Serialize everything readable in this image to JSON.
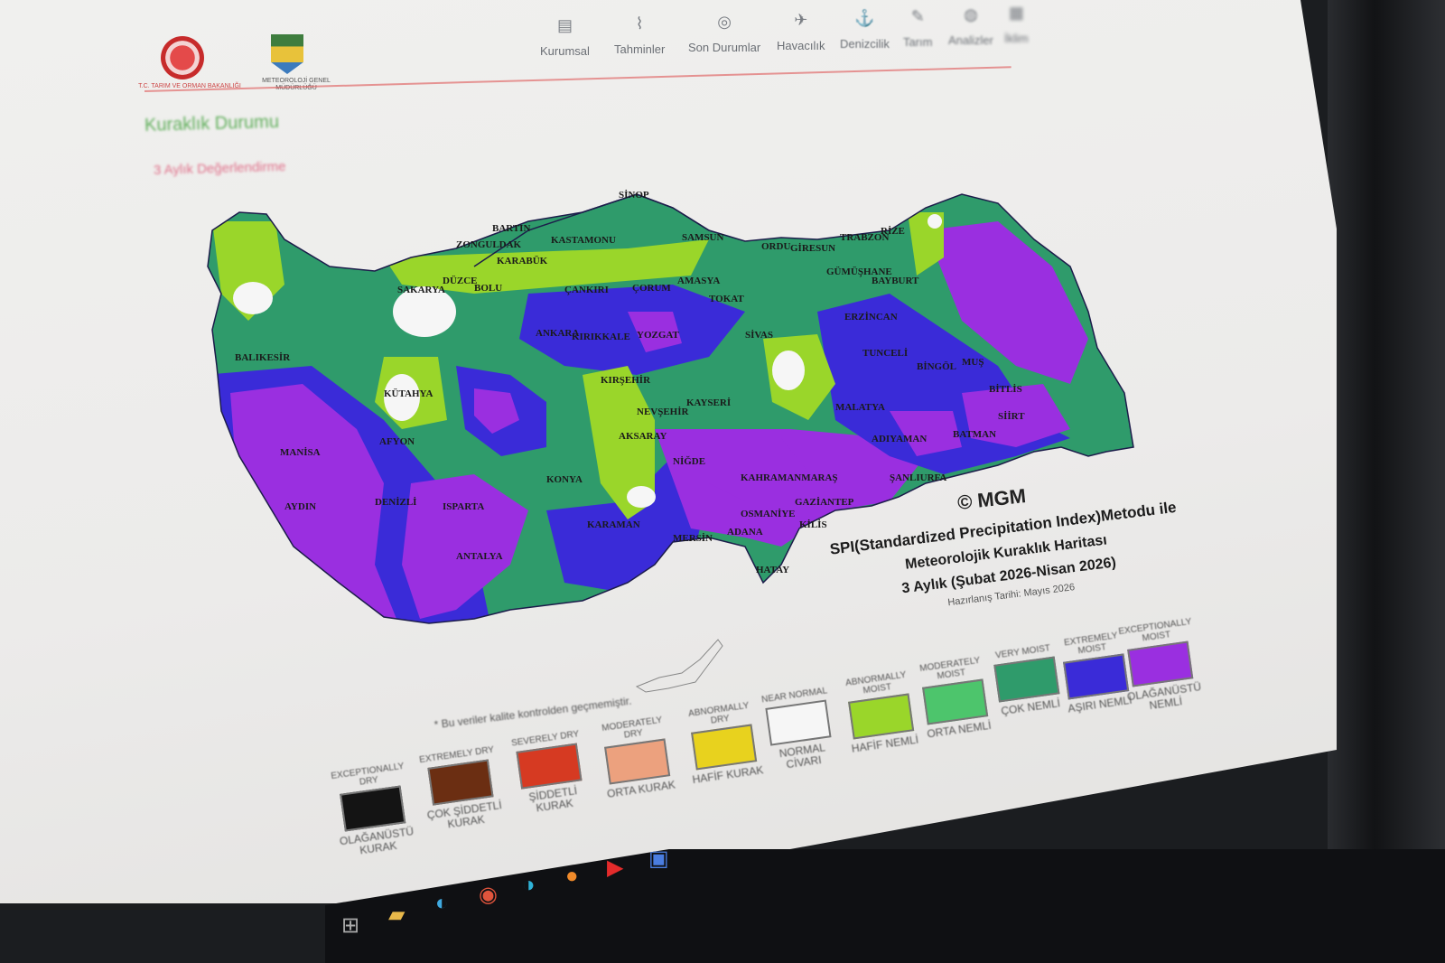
{
  "header": {
    "logo1_caption": "T.C. TARIM VE ORMAN BAKANLIĞI",
    "logo2_caption": "METEOROLOJİ GENEL MÜDÜRLÜĞÜ",
    "nav": [
      {
        "label": "Kurumsal",
        "icon": "building-icon"
      },
      {
        "label": "Tahminler",
        "icon": "chart-icon"
      },
      {
        "label": "Son Durumlar",
        "icon": "check-circle-icon"
      },
      {
        "label": "Havacılık",
        "icon": "plane-icon"
      },
      {
        "label": "Denizcilik",
        "icon": "anchor-icon"
      },
      {
        "label": "Tarım",
        "icon": "leaf-icon"
      },
      {
        "label": "Analizler",
        "icon": "drop-icon"
      },
      {
        "label": "İklim",
        "icon": "grid-icon"
      }
    ]
  },
  "page": {
    "section_title": "Kuraklık Durumu",
    "subsection_title": "3 Aylık Değerlendirme"
  },
  "map": {
    "copyright": "© MGM",
    "title_line1": "SPI(Standardized Precipitation Index)Metodu ile",
    "title_line2": "Meteorolojik Kuraklık Haritası",
    "title_line3": "3 Aylık (Şubat 2026-Nisan 2026)",
    "prepared": "Hazırlanış Tarihi: Mayıs 2026",
    "note": "* Bu veriler kalite kontrolden geçmemiştir.",
    "cities": [
      "SİNOP",
      "BARTIN",
      "ZONGULDAK",
      "KASTAMONU",
      "KARABÜK",
      "SAMSUN",
      "ORDU",
      "GİRESUN",
      "TRABZON",
      "RİZE",
      "SAKARYA",
      "DÜZCE",
      "BOLU",
      "ÇANKIRI",
      "ÇORUM",
      "AMASYA",
      "TOKAT",
      "GÜMÜŞHANE",
      "BAYBURT",
      "ANKARA",
      "KIRIKKALE",
      "YOZGAT",
      "SİVAS",
      "ERZİNCAN",
      "TUNCELİ",
      "BİNGÖL",
      "MUŞ",
      "BİTLİS",
      "KÜTAHYA",
      "KIRŞEHİR",
      "NEVŞEHİR",
      "KAYSERİ",
      "MALATYA",
      "AFYON",
      "AKSARAY",
      "NİĞDE",
      "ADIYAMAN",
      "KONYA",
      "KAHRAMANMARAŞ",
      "ŞANLIURFA",
      "BATMAN",
      "SİİRT",
      "DENİZLİ",
      "ISPARTA",
      "KARAMAN",
      "MERSİN",
      "ADANA",
      "OSMANİYE",
      "GAZİANTEP",
      "KİLİS",
      "ANTALYA",
      "HATAY",
      "AYDIN",
      "MANİSA",
      "BALIKESİR"
    ]
  },
  "legend": [
    {
      "en": "EXCEPTIONALLY DRY",
      "tr": "OLAĞANÜSTÜ KURAK",
      "color": "#141414"
    },
    {
      "en": "EXTREMELY DRY",
      "tr": "ÇOK ŞİDDETLİ KURAK",
      "color": "#6b2e12"
    },
    {
      "en": "SEVERELY DRY",
      "tr": "ŞİDDETLİ KURAK",
      "color": "#d63a22"
    },
    {
      "en": "MODERATELY DRY",
      "tr": "ORTA KURAK",
      "color": "#eca17e"
    },
    {
      "en": "ABNORMALLY DRY",
      "tr": "HAFİF KURAK",
      "color": "#e8d21e"
    },
    {
      "en": "NEAR NORMAL",
      "tr": "NORMAL CİVARI",
      "color": "#f6f6f6"
    },
    {
      "en": "ABNORMALLY MOIST",
      "tr": "HAFİF NEMLİ",
      "color": "#9ad62a"
    },
    {
      "en": "MODERATELY MOIST",
      "tr": "ORTA NEMLİ",
      "color": "#4dc56c"
    },
    {
      "en": "VERY MOIST",
      "tr": "ÇOK NEMLİ",
      "color": "#2f9b6b"
    },
    {
      "en": "EXTREMELY MOIST",
      "tr": "AŞIRI NEMLİ",
      "color": "#3a2bd8"
    },
    {
      "en": "EXCEPTIONALLY MOIST",
      "tr": "OLAĞANÜSTÜ NEMLİ",
      "color": "#9a2fe0"
    }
  ],
  "taskbar": {
    "icons": [
      "start-icon",
      "file-explorer-icon",
      "edge-icon",
      "chrome-icon",
      "edge-new-icon",
      "firefox-icon",
      "youtube-icon",
      "word-icon"
    ]
  },
  "colors": {
    "map_purple": "#9a2fe0",
    "map_blue": "#3a2bd8",
    "map_teal": "#2f9b6b",
    "map_green": "#4dc56c",
    "map_lime": "#9ad62a",
    "map_white": "#f6f6f6"
  }
}
